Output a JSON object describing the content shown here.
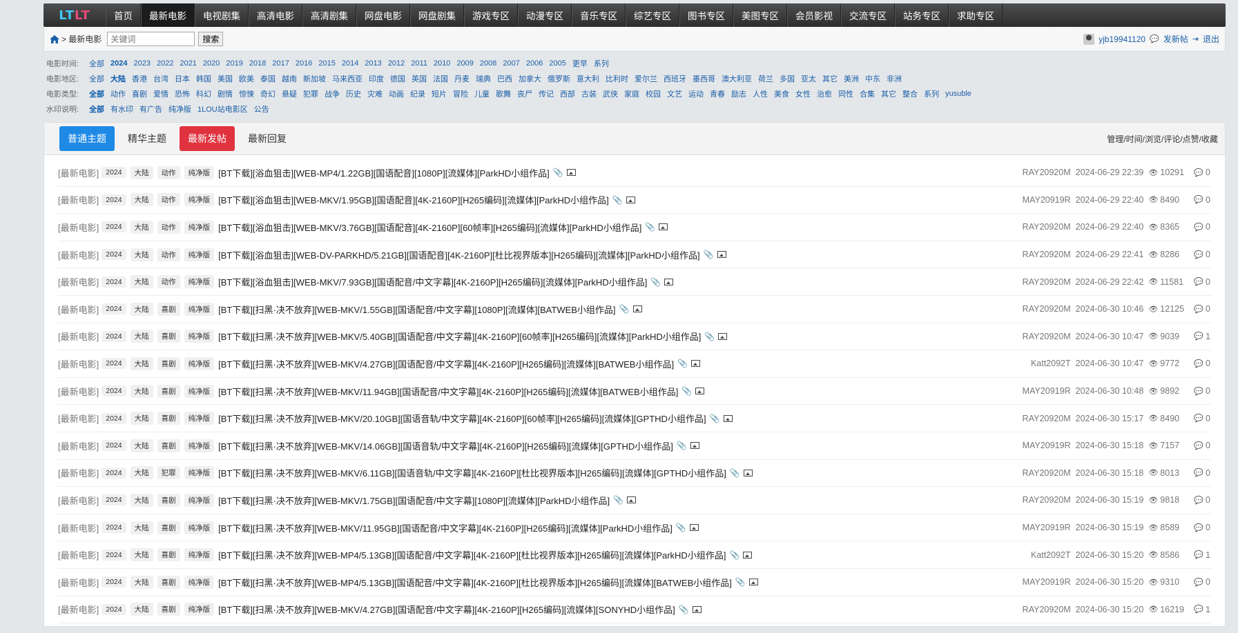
{
  "nav": {
    "logo": [
      "LT",
      "LT"
    ],
    "items": [
      "首页",
      "最新电影",
      "电视剧集",
      "高清电影",
      "高清剧集",
      "网盘电影",
      "网盘剧集",
      "游戏专区",
      "动漫专区",
      "音乐专区",
      "综艺专区",
      "图书专区",
      "美图专区",
      "会员影视",
      "交流专区",
      "站务专区",
      "求助专区"
    ],
    "active_index": 1
  },
  "toolbar": {
    "breadcrumb": "> 最新电影",
    "search_placeholder": "关键词",
    "search_button": "搜索",
    "username": "yjb19941120",
    "post_link": "发新帖",
    "logout_link": "退出"
  },
  "filters": {
    "time": {
      "label": "电影时间:",
      "options": [
        "全部",
        "2024",
        "2023",
        "2022",
        "2021",
        "2020",
        "2019",
        "2018",
        "2017",
        "2016",
        "2015",
        "2014",
        "2013",
        "2012",
        "2011",
        "2010",
        "2009",
        "2008",
        "2007",
        "2006",
        "2005",
        "更早",
        "系列"
      ],
      "selected": "2024"
    },
    "region": {
      "label": "电影地区:",
      "options": [
        "全部",
        "大陆",
        "香港",
        "台湾",
        "日本",
        "韩国",
        "美国",
        "欧美",
        "泰国",
        "越南",
        "新加坡",
        "马来西亚",
        "印度",
        "德国",
        "英国",
        "法国",
        "丹麦",
        "瑞典",
        "巴西",
        "加拿大",
        "俄罗斯",
        "意大利",
        "比利时",
        "爱尔兰",
        "西班牙",
        "墨西哥",
        "澳大利亚",
        "荷兰",
        "多国",
        "亚太",
        "其它",
        "美洲",
        "中东",
        "非洲"
      ],
      "selected": "大陆"
    },
    "genre": {
      "label": "电影类型:",
      "options": [
        "全部",
        "动作",
        "喜剧",
        "爱情",
        "恐怖",
        "科幻",
        "剧情",
        "惊悚",
        "奇幻",
        "悬疑",
        "犯罪",
        "战争",
        "历史",
        "灾难",
        "动画",
        "纪录",
        "短片",
        "冒险",
        "儿童",
        "歌舞",
        "丧尸",
        "传记",
        "西部",
        "古装",
        "武侠",
        "家庭",
        "校园",
        "文艺",
        "运动",
        "青春",
        "励志",
        "人性",
        "美食",
        "女性",
        "治愈",
        "同性",
        "合集",
        "其它",
        "整合",
        "系列",
        "yusuble"
      ],
      "selected": "全部"
    },
    "watermark": {
      "label": "水印说明:",
      "options": [
        "全部",
        "有水印",
        "有广告",
        "纯净版",
        "1LOU站电影区",
        "公告"
      ],
      "selected": "全部"
    }
  },
  "tabs": {
    "items": [
      "普通主题",
      "精华主题",
      "最新发帖",
      "最新回复"
    ],
    "sort_info": "管理/时间/浏览/评论/点赞/收藏"
  },
  "threads": [
    {
      "category": "[最新电影]",
      "year": "2024",
      "region": "大陆",
      "genre": "动作",
      "version": "纯净版",
      "title": "[BT下载][浴血狙击][WEB-MP4/1.22GB][国语配音][1080P][流媒体][ParkHD小组作品]",
      "author": "RAY20920M",
      "date": "2024-06-29 22:39",
      "views": "10291",
      "replies": "0"
    },
    {
      "category": "[最新电影]",
      "year": "2024",
      "region": "大陆",
      "genre": "动作",
      "version": "纯净版",
      "title": "[BT下载][浴血狙击][WEB-MKV/1.95GB][国语配音][4K-2160P][H265编码][流媒体][ParkHD小组作品]",
      "author": "MAY20919R",
      "date": "2024-06-29 22:40",
      "views": "8490",
      "replies": "0"
    },
    {
      "category": "[最新电影]",
      "year": "2024",
      "region": "大陆",
      "genre": "动作",
      "version": "纯净版",
      "title": "[BT下载][浴血狙击][WEB-MKV/3.76GB][国语配音][4K-2160P][60帧率][H265编码][流媒体][ParkHD小组作品]",
      "author": "RAY20920M",
      "date": "2024-06-29 22:40",
      "views": "8365",
      "replies": "0"
    },
    {
      "category": "[最新电影]",
      "year": "2024",
      "region": "大陆",
      "genre": "动作",
      "version": "纯净版",
      "title": "[BT下载][浴血狙击][WEB-DV-PARKHD/5.21GB][国语配音][4K-2160P][杜比视界版本][H265编码][流媒体][ParkHD小组作品]",
      "author": "RAY20920M",
      "date": "2024-06-29 22:41",
      "views": "8286",
      "replies": "0"
    },
    {
      "category": "[最新电影]",
      "year": "2024",
      "region": "大陆",
      "genre": "动作",
      "version": "纯净版",
      "title": "[BT下载][浴血狙击][WEB-MKV/7.93GB][国语配音/中文字幕][4K-2160P][H265编码][流媒体][ParkHD小组作品]",
      "author": "RAY20920M",
      "date": "2024-06-29 22:42",
      "views": "11581",
      "replies": "0"
    },
    {
      "category": "[最新电影]",
      "year": "2024",
      "region": "大陆",
      "genre": "喜剧",
      "version": "纯净版",
      "title": "[BT下载][扫黑·决不放弃][WEB-MKV/1.55GB][国语配音/中文字幕][1080P][流媒体][BATWEB小组作品]",
      "author": "RAY20920M",
      "date": "2024-06-30 10:46",
      "views": "12125",
      "replies": "0"
    },
    {
      "category": "[最新电影]",
      "year": "2024",
      "region": "大陆",
      "genre": "喜剧",
      "version": "纯净版",
      "title": "[BT下载][扫黑·决不放弃][WEB-MKV/5.40GB][国语配音/中文字幕][4K-2160P][60帧率][H265编码][流媒体][ParkHD小组作品]",
      "author": "RAY20920M",
      "date": "2024-06-30 10:47",
      "views": "9039",
      "replies": "1"
    },
    {
      "category": "[最新电影]",
      "year": "2024",
      "region": "大陆",
      "genre": "喜剧",
      "version": "纯净版",
      "title": "[BT下载][扫黑·决不放弃][WEB-MKV/4.27GB][国语配音/中文字幕][4K-2160P][H265编码][流媒体][BATWEB小组作品]",
      "author": "Katt2092T",
      "date": "2024-06-30 10:47",
      "views": "9772",
      "replies": "0"
    },
    {
      "category": "[最新电影]",
      "year": "2024",
      "region": "大陆",
      "genre": "喜剧",
      "version": "纯净版",
      "title": "[BT下载][扫黑·决不放弃][WEB-MKV/11.94GB][国语配音/中文字幕][4K-2160P][H265编码][流媒体][BATWEB小组作品]",
      "author": "MAY20919R",
      "date": "2024-06-30 10:48",
      "views": "9892",
      "replies": "0"
    },
    {
      "category": "[最新电影]",
      "year": "2024",
      "region": "大陆",
      "genre": "喜剧",
      "version": "纯净版",
      "title": "[BT下载][扫黑·决不放弃][WEB-MKV/20.10GB][国语音轨/中文字幕][4K-2160P][60帧率][H265编码][流媒体][GPTHD小组作品]",
      "author": "RAY20920M",
      "date": "2024-06-30 15:17",
      "views": "8490",
      "replies": "0"
    },
    {
      "category": "[最新电影]",
      "year": "2024",
      "region": "大陆",
      "genre": "喜剧",
      "version": "纯净版",
      "title": "[BT下载][扫黑·决不放弃][WEB-MKV/14.06GB][国语音轨/中文字幕][4K-2160P][H265编码][流媒体][GPTHD小组作品]",
      "author": "MAY20919R",
      "date": "2024-06-30 15:18",
      "views": "7157",
      "replies": "0"
    },
    {
      "category": "[最新电影]",
      "year": "2024",
      "region": "大陆",
      "genre": "犯罪",
      "version": "纯净版",
      "title": "[BT下载][扫黑·决不放弃][WEB-MKV/6.11GB][国语音轨/中文字幕][4K-2160P][杜比视界版本][H265编码][流媒体][GPTHD小组作品]",
      "author": "RAY20920M",
      "date": "2024-06-30 15:18",
      "views": "8013",
      "replies": "0"
    },
    {
      "category": "[最新电影]",
      "year": "2024",
      "region": "大陆",
      "genre": "喜剧",
      "version": "纯净版",
      "title": "[BT下载][扫黑·决不放弃][WEB-MKV/1.75GB][国语配音/中文字幕][1080P][流媒体][ParkHD小组作品]",
      "author": "RAY20920M",
      "date": "2024-06-30 15:19",
      "views": "9818",
      "replies": "0"
    },
    {
      "category": "[最新电影]",
      "year": "2024",
      "region": "大陆",
      "genre": "喜剧",
      "version": "纯净版",
      "title": "[BT下载][扫黑·决不放弃][WEB-MKV/11.95GB][国语配音/中文字幕][4K-2160P][H265编码][流媒体][ParkHD小组作品]",
      "author": "MAY20919R",
      "date": "2024-06-30 15:19",
      "views": "8589",
      "replies": "0"
    },
    {
      "category": "[最新电影]",
      "year": "2024",
      "region": "大陆",
      "genre": "喜剧",
      "version": "纯净版",
      "title": "[BT下载][扫黑·决不放弃][WEB-MP4/5.13GB][国语配音/中文字幕][4K-2160P][杜比视界版本][H265编码][流媒体][ParkHD小组作品]",
      "author": "Katt2092T",
      "date": "2024-06-30 15:20",
      "views": "8586",
      "replies": "1"
    },
    {
      "category": "[最新电影]",
      "year": "2024",
      "region": "大陆",
      "genre": "喜剧",
      "version": "纯净版",
      "title": "[BT下载][扫黑·决不放弃][WEB-MP4/5.13GB][国语配音/中文字幕][4K-2160P][杜比视界版本][H265编码][流媒体][BATWEB小组作品]",
      "author": "MAY20919R",
      "date": "2024-06-30 15:20",
      "views": "9310",
      "replies": "0"
    },
    {
      "category": "[最新电影]",
      "year": "2024",
      "region": "大陆",
      "genre": "喜剧",
      "version": "纯净版",
      "title": "[BT下载][扫黑·决不放弃][WEB-MKV/4.27GB][国语配音/中文字幕][4K-2160P][H265编码][流媒体][SONYHD小组作品]",
      "author": "RAY20920M",
      "date": "2024-06-30 15:20",
      "views": "16219",
      "replies": "1"
    }
  ],
  "colors": {
    "nav_bg": "#3a3a3a",
    "link": "#1a5fa8",
    "tab_active": "#1e8ae6",
    "tab_new_post": "#e0333f"
  }
}
